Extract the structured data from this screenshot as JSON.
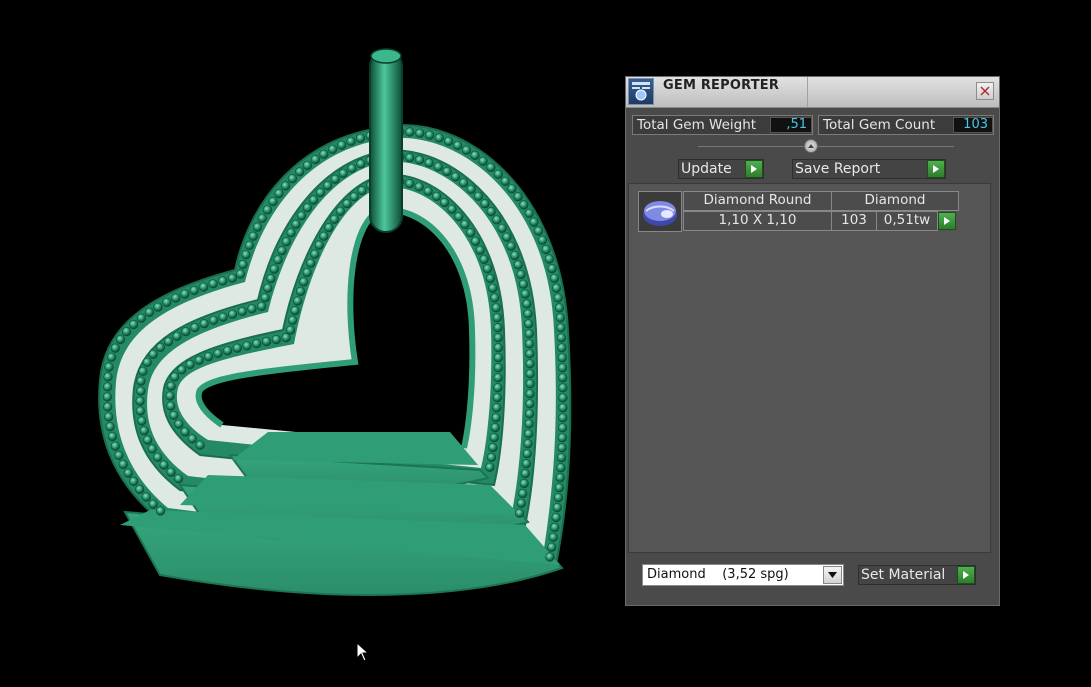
{
  "panel": {
    "title": "GEM REPORTER",
    "total_weight_label": "Total Gem Weight",
    "total_weight_value": ",51",
    "total_count_label": "Total Gem Count",
    "total_count_value": "103",
    "update_label": "Update",
    "save_report_label": "Save Report",
    "table": {
      "header": [
        "Diamond Round",
        "Diamond"
      ],
      "row": {
        "size": "1,10 X 1,10",
        "count": "103",
        "weight": "0,51tw"
      }
    },
    "material_select": "Diamond    (3,52 spg)",
    "set_material_label": "Set Material"
  },
  "icons": {
    "app": "gem-reporter-app-icon",
    "close": "close-icon",
    "go": "green-play-arrow-icon",
    "gem": "diamond-gem-icon",
    "dropdown": "chevron-down-icon",
    "cursor": "mouse-pointer-icon"
  },
  "colors": {
    "gold_body": "#2f9e76",
    "value_text": "#49c6e5",
    "go_button": "#3a973a"
  }
}
